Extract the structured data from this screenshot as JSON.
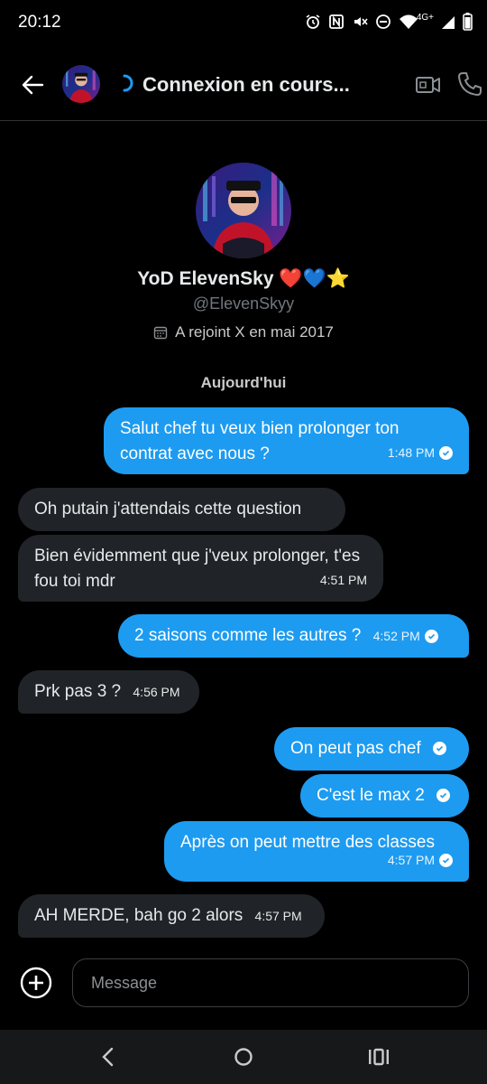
{
  "status_bar": {
    "time": "20:12",
    "network": "4G+",
    "icons": [
      "alarm-icon",
      "nfc-icon",
      "mute-icon",
      "dnd-icon",
      "wifi-icon",
      "signal-icon",
      "battery-icon"
    ]
  },
  "header": {
    "title": "Connexion en cours...",
    "icons": [
      "back-arrow-icon",
      "spinner-icon",
      "video-call-icon",
      "phone-call-icon"
    ]
  },
  "profile": {
    "name": "YoD ElevenSky ❤️💙⭐",
    "handle": "@ElevenSkyy",
    "joined": "A rejoint X en mai 2017"
  },
  "date_separator": "Aujourd'hui",
  "messages": [
    {
      "side": "out",
      "text": "Salut chef tu veux bien prolonger ton contrat avec nous ?",
      "time": "1:48 PM",
      "read": true
    },
    {
      "side": "in",
      "text": "Oh putain j'attendais cette question",
      "time": "",
      "read": false
    },
    {
      "side": "in",
      "text": "Bien évidemment que j'veux prolonger, t'es fou toi mdr",
      "time": "4:51 PM",
      "read": false
    },
    {
      "side": "out",
      "text": "2 saisons comme les autres ?",
      "time": "4:52 PM",
      "read": true
    },
    {
      "side": "in",
      "text": "Prk pas 3 ?",
      "time": "4:56 PM",
      "read": false
    },
    {
      "side": "out",
      "text": "On peut pas chef",
      "time": "",
      "read": true
    },
    {
      "side": "out",
      "text": "C'est le max 2",
      "time": "",
      "read": true
    },
    {
      "side": "out",
      "text": "Après on peut mettre des classes",
      "time": "4:57 PM",
      "read": true
    },
    {
      "side": "in",
      "text": "AH MERDE, bah go 2 alors",
      "time": "4:57 PM",
      "read": false
    }
  ],
  "composer": {
    "placeholder": "Message",
    "icons": [
      "plus-icon"
    ]
  },
  "nav_bar": {
    "icons": [
      "nav-back-icon",
      "nav-home-icon",
      "nav-recent-apps-icon"
    ]
  },
  "colors": {
    "accent": "#1d9bf0",
    "incoming_bubble": "#202327",
    "background": "#000000"
  }
}
